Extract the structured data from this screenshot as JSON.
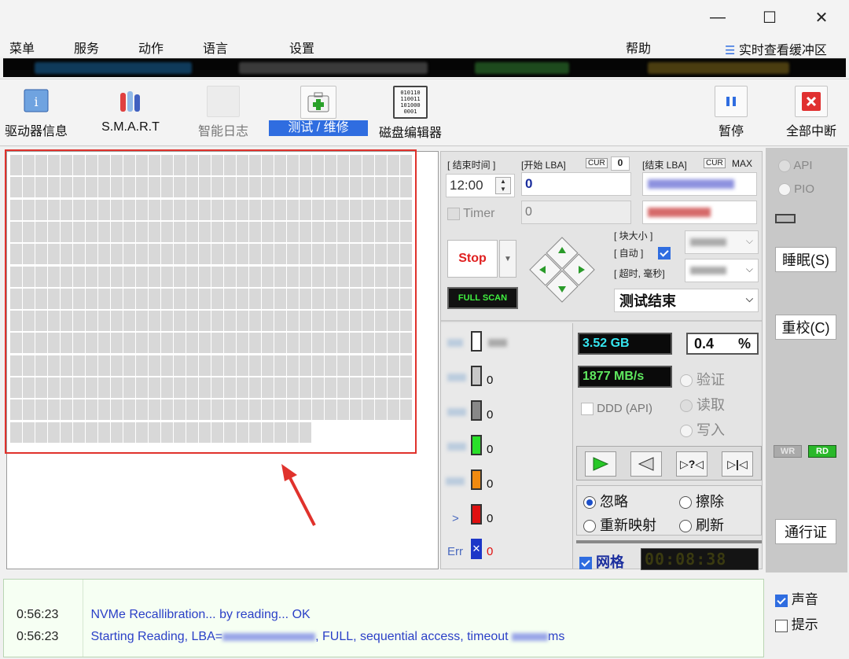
{
  "window": {
    "minimize": "—",
    "maximize": "☐",
    "close": "✕"
  },
  "menu": {
    "items": [
      "菜单",
      "服务",
      "动作",
      "语言",
      "设置"
    ],
    "help": "帮助",
    "buffer_view": "实时查看缓冲区"
  },
  "toolbar": {
    "drive_info": "驱动器信息",
    "smart": "S.M.A.R.T",
    "smart_log": "智能日志",
    "test_repair": "测试 / 维修",
    "disk_editor": "磁盘编辑器",
    "disk_editor_icon_text": "010110\n110011\n101000\n0001",
    "pause": "暂停",
    "abort_all": "全部中断"
  },
  "controls": {
    "end_time_label": "[ 结束时间 ]",
    "start_lba_label": "[开始 LBA]",
    "cur_label": "CUR",
    "cur_value": "0",
    "end_lba_label": "[结束 LBA]",
    "cur2_label": "CUR",
    "max_label": "MAX",
    "end_time_value": "12:00",
    "start_lba_value": "0",
    "timer_label": "Timer",
    "timer_value": "0",
    "stop_label": "Stop",
    "full_scan_label": "FULL SCAN",
    "block_size_label": "[ 块大小 ]",
    "auto_label": "[ 自动 ]",
    "timeout_label": "[ 超时, 毫秒]",
    "status_select": "测试结束"
  },
  "stats": {
    "size": "3.52 GB",
    "percent": "0.4",
    "percent_unit": "%",
    "speed": "1877 MB/s",
    "verify": "验证",
    "read": "读取",
    "write": "写入",
    "ddd_api": "DDD (API)",
    "legend_counts": [
      "0",
      "0",
      "0",
      "0",
      "0",
      "0"
    ],
    "legend_gt": ">",
    "err_label": "Err",
    "err_count": "0",
    "ignore": "忽略",
    "erase": "擦除",
    "remap": "重新映射",
    "refresh": "刷新",
    "grid_label": "网格",
    "timer_display": "00:08:38"
  },
  "sidebar": {
    "api": "API",
    "pio": "PIO",
    "sleep": "睡眠(S)",
    "recalibrate": "重校(C)",
    "wr": "WR",
    "rd": "RD",
    "passport": "通行证"
  },
  "log": {
    "rows": [
      {
        "time": "0:56:23",
        "msg": "NVMe Recallibration...  by reading... OK"
      },
      {
        "time": "0:56:23",
        "msg_a": "Starting Reading, LBA=",
        "msg_b": ", FULL, sequential access, timeout ",
        "msg_c": "ms"
      }
    ],
    "sound": "声音",
    "hint": "提示"
  },
  "colors": {
    "accent_blue": "#2f6de0",
    "highlight_red": "#e0322c",
    "lcd_cyan": "#36e6f0",
    "lcd_green": "#5fe85f",
    "lcd_white": "#ffffff"
  }
}
